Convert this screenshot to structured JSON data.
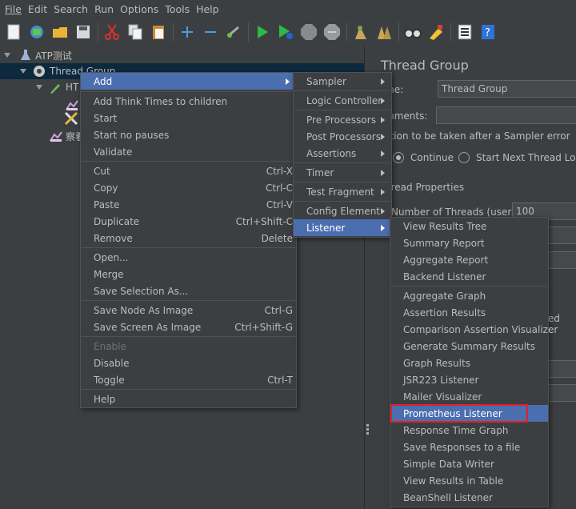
{
  "menubar": {
    "items": [
      "File",
      "Edit",
      "Search",
      "Run",
      "Options",
      "Tools",
      "Help"
    ]
  },
  "tree": {
    "root": "ATP测试",
    "thread_group": "Thread Group",
    "http_partial": "HT",
    "child_partial": "察看"
  },
  "right_panel": {
    "title": "Thread Group",
    "name_label": "me:",
    "name_value": "Thread Group",
    "comments_label": "mments:",
    "action_label": "ction to be taken after a Sampler error",
    "continue_label": "Continue",
    "start_next_label": "Start Next Thread Loop",
    "thread_props": "hread Properties",
    "num_threads_label": "Number of Threads (users):",
    "num_threads_value": "100",
    "partial_ed": "ed"
  },
  "context_menu": {
    "items": [
      {
        "label": "Add",
        "accel": "",
        "submenu": true
      },
      {
        "label": "Add Think Times to children",
        "accel": ""
      },
      {
        "label": "Start",
        "accel": ""
      },
      {
        "label": "Start no pauses",
        "accel": ""
      },
      {
        "label": "Validate",
        "accel": ""
      },
      {
        "label": "Cut",
        "accel": "Ctrl-X"
      },
      {
        "label": "Copy",
        "accel": "Ctrl-C"
      },
      {
        "label": "Paste",
        "accel": "Ctrl-V"
      },
      {
        "label": "Duplicate",
        "accel": "Ctrl+Shift-C"
      },
      {
        "label": "Remove",
        "accel": "Delete"
      },
      {
        "label": "Open...",
        "accel": ""
      },
      {
        "label": "Merge",
        "accel": ""
      },
      {
        "label": "Save Selection As...",
        "accel": ""
      },
      {
        "label": "Save Node As Image",
        "accel": "Ctrl-G"
      },
      {
        "label": "Save Screen As Image",
        "accel": "Ctrl+Shift-G"
      },
      {
        "label": "Enable",
        "accel": ""
      },
      {
        "label": "Disable",
        "accel": ""
      },
      {
        "label": "Toggle",
        "accel": "Ctrl-T"
      },
      {
        "label": "Help",
        "accel": ""
      }
    ]
  },
  "add_submenu": {
    "items": [
      "Sampler",
      "Logic Controller",
      "Pre Processors",
      "Post Processors",
      "Assertions",
      "Timer",
      "Test Fragment",
      "Config Element",
      "Listener"
    ]
  },
  "listener_submenu": {
    "items": [
      "View Results Tree",
      "Summary Report",
      "Aggregate Report",
      "Backend Listener",
      "Aggregate Graph",
      "Assertion Results",
      "Comparison Assertion Visualizer",
      "Generate Summary Results",
      "Graph Results",
      "JSR223 Listener",
      "Mailer Visualizer",
      "Prometheus Listener",
      "Response Time Graph",
      "Save Responses to a file",
      "Simple Data Writer",
      "View Results in Table",
      "BeanShell Listener"
    ]
  },
  "colors": {
    "background": "#3c3f41",
    "menu_active": "#4b6eaf",
    "highlight_box": "#e0202a",
    "text": "#bbbbbb"
  }
}
